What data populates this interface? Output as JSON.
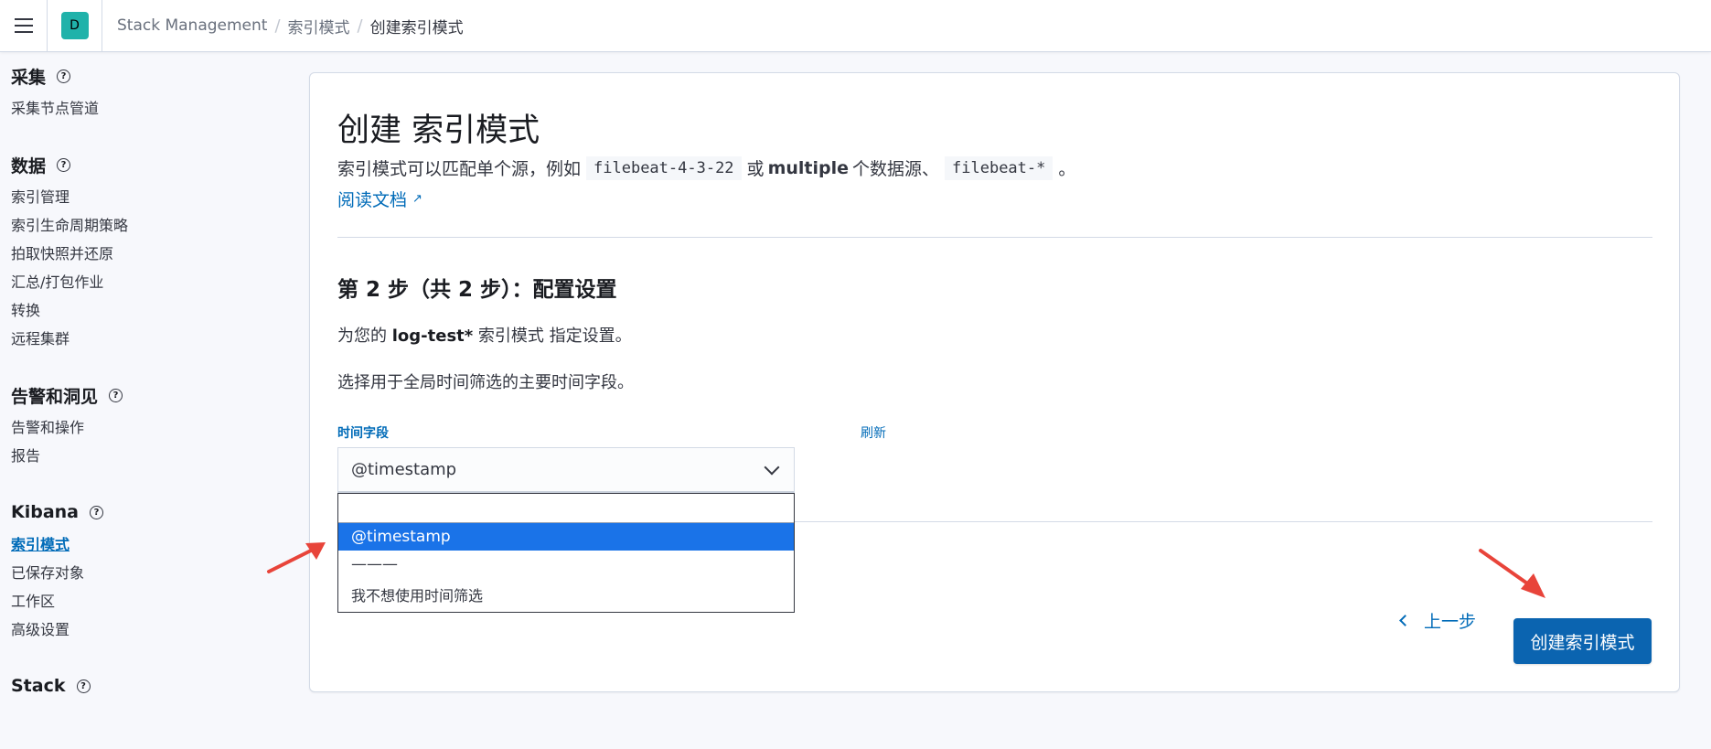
{
  "header": {
    "space_initial": "D",
    "breadcrumbs": [
      "Stack Management",
      "索引模式",
      "创建索引模式"
    ]
  },
  "sidebar": {
    "groups": [
      {
        "title": "采集",
        "items": [
          "采集节点管道"
        ]
      },
      {
        "title": "数据",
        "items": [
          "索引管理",
          "索引生命周期策略",
          "拍取快照并还原",
          "汇总/打包作业",
          "转换",
          "远程集群"
        ]
      },
      {
        "title": "告警和洞见",
        "items": [
          "告警和操作",
          "报告"
        ]
      },
      {
        "title": "Kibana",
        "items": [
          "索引模式",
          "已保存对象",
          "工作区",
          "高级设置"
        ]
      },
      {
        "title": "Stack",
        "items": []
      }
    ],
    "active_item": "索引模式"
  },
  "main": {
    "title": "创建 索引模式",
    "desc_prefix": "索引模式可以匹配单个源，例如",
    "desc_code1": "filebeat-4-3-22",
    "desc_or": "或",
    "desc_multiple": "multiple",
    "desc_mid": "个数据源、",
    "desc_code2": "filebeat-*",
    "desc_end": "。",
    "doc_link": "阅读文档",
    "step_title": "第 2 步（共 2 步）：配置设置",
    "settings_prefix": "为您的",
    "index_pattern": "log-test*",
    "settings_suffix": "索引模式 指定设置。",
    "time_desc": "选择用于全局时间筛选的主要时间字段。",
    "field_label": "时间字段",
    "refresh_label": "刷新",
    "selected_value": "@timestamp",
    "dropdown_options": [
      "@timestamp",
      "———",
      "我不想使用时间筛选"
    ],
    "back_label": "上一步",
    "create_label": "创建索引模式"
  },
  "colors": {
    "accent": "#006bb8",
    "primary_button": "#0b64b0",
    "selected_option": "#1a73e8",
    "annotation_arrow": "#e8443a",
    "space_avatar": "#20b2aa"
  }
}
